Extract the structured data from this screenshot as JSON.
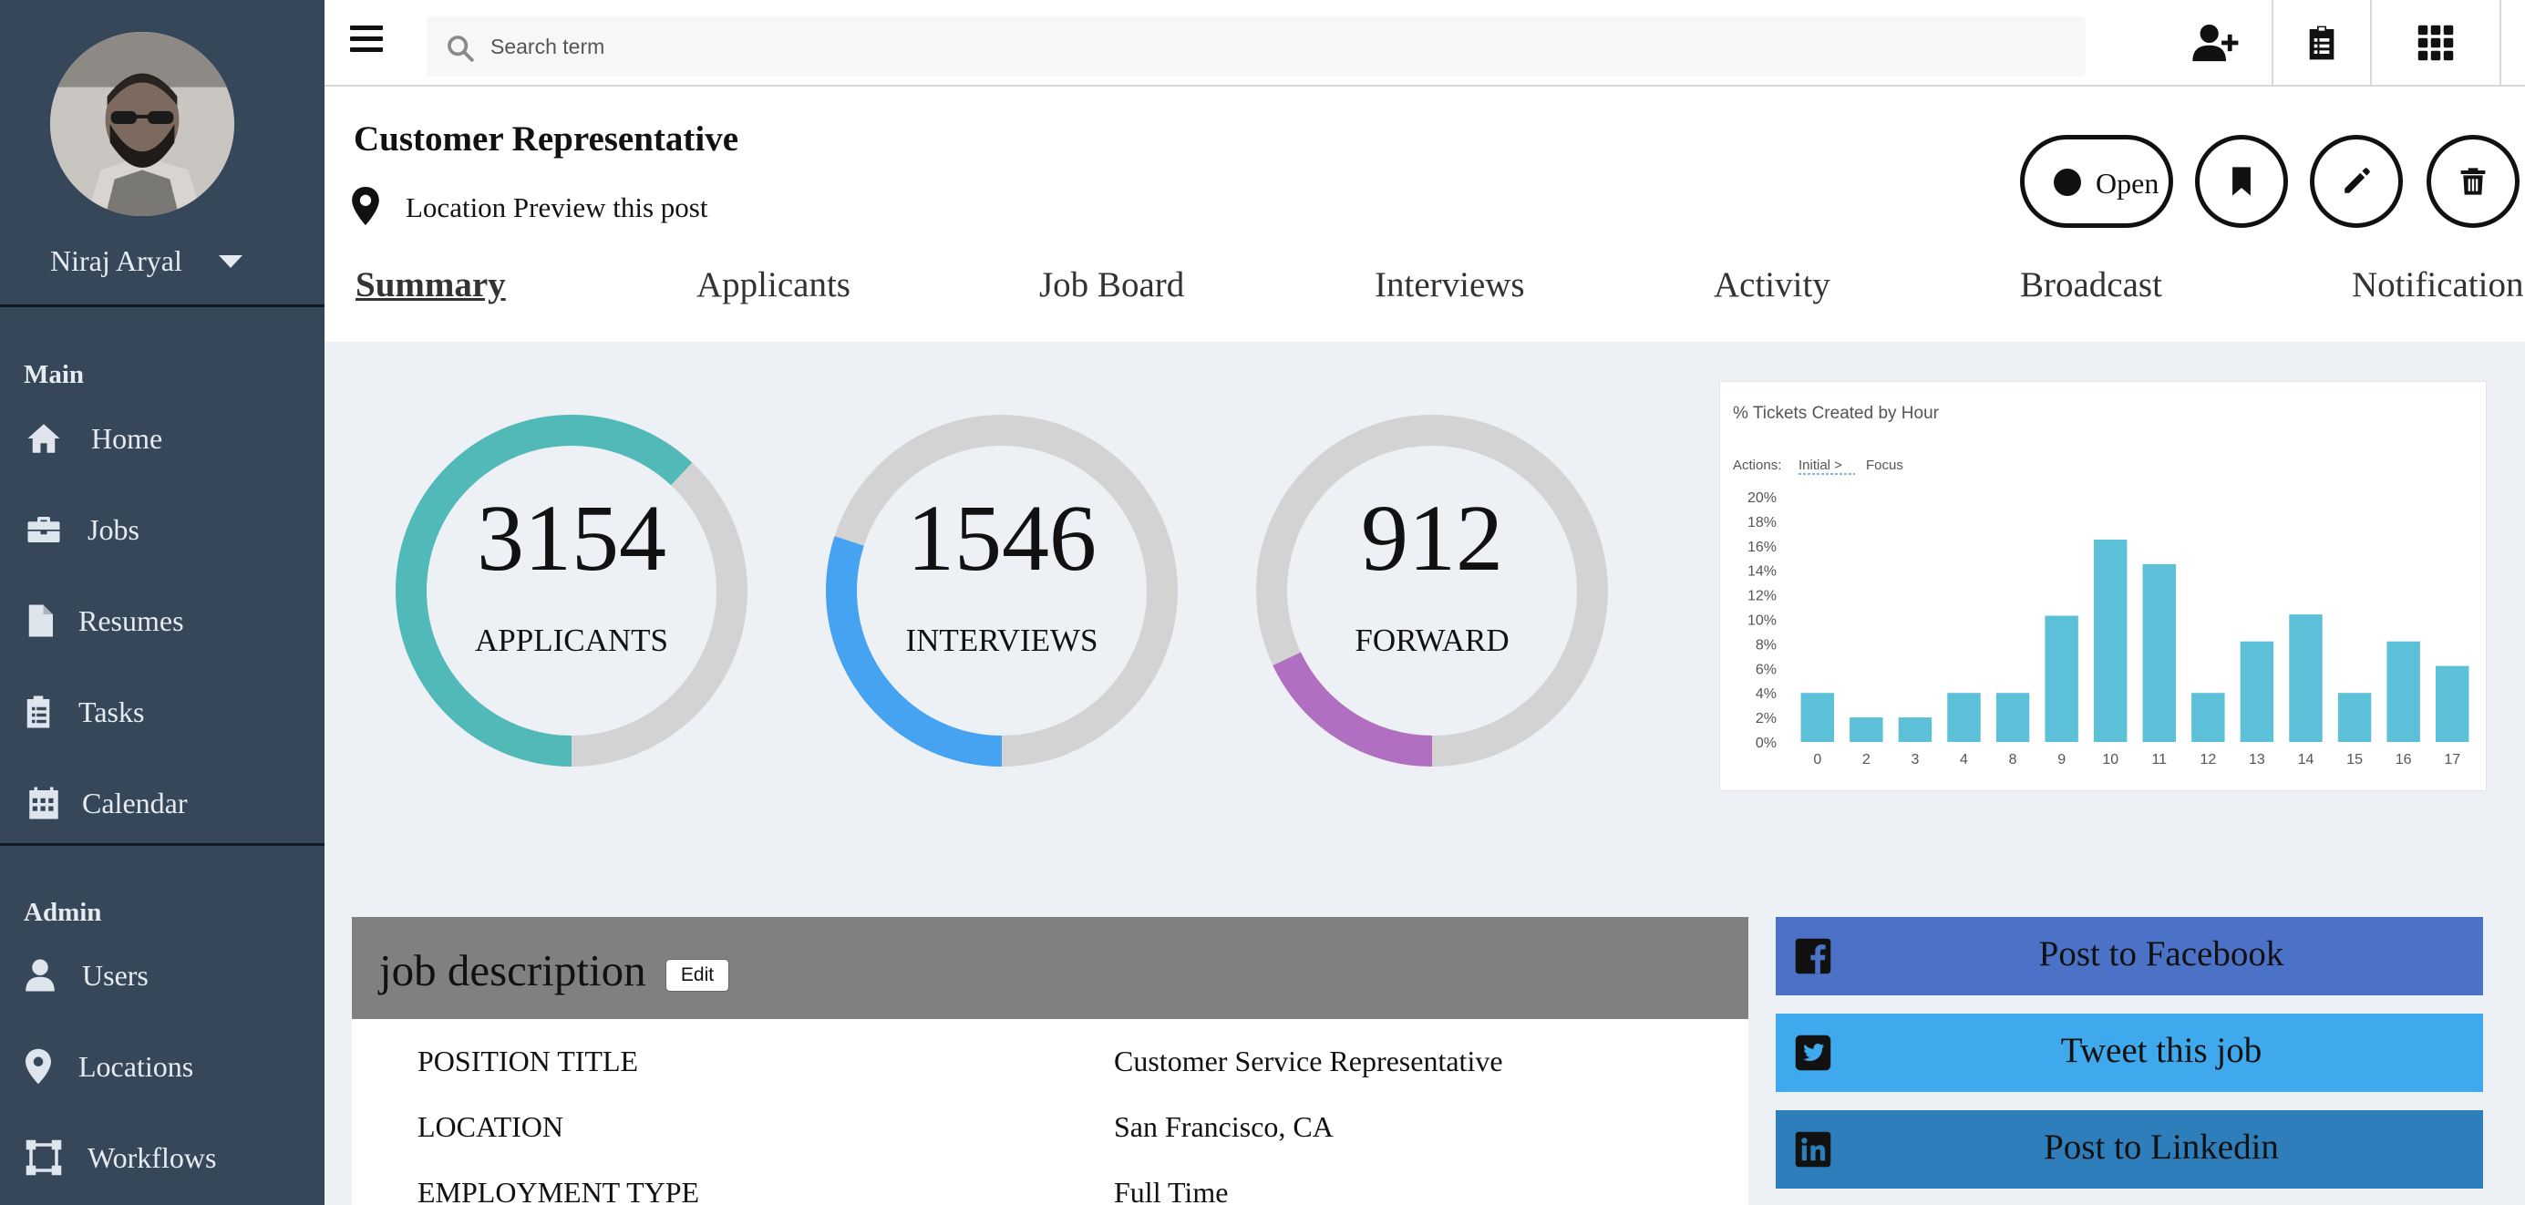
{
  "sidebar": {
    "user_name": "Niraj Aryal",
    "sections": {
      "main": "Main",
      "admin": "Admin"
    },
    "items": [
      {
        "label": "Home",
        "icon": "home-icon"
      },
      {
        "label": "Jobs",
        "icon": "briefcase-icon"
      },
      {
        "label": "Resumes",
        "icon": "file-icon"
      },
      {
        "label": "Tasks",
        "icon": "clipboard-list-icon"
      },
      {
        "label": "Calendar",
        "icon": "calendar-icon"
      },
      {
        "label": "Users",
        "icon": "user-icon"
      },
      {
        "label": "Locations",
        "icon": "map-pin-icon"
      },
      {
        "label": "Workflows",
        "icon": "workflow-icon"
      }
    ]
  },
  "topbar": {
    "search_placeholder": "Search term",
    "icons": [
      "menu-icon",
      "search-icon",
      "add-user-icon",
      "clipboard-icon",
      "apps-grid-icon"
    ]
  },
  "header": {
    "title": "Customer Representative",
    "location_text": "Location Preview this post",
    "open_label": "Open"
  },
  "tabs": [
    "Summary",
    "Applicants",
    "Job Board",
    "Interviews",
    "Activity",
    "Broadcast",
    "Notification"
  ],
  "stats": [
    {
      "value": "3154",
      "label": "APPLICANTS",
      "fraction": 0.62,
      "color": "#52b9b9"
    },
    {
      "value": "1546",
      "label": "INTERVIEWS",
      "fraction": 0.3,
      "color": "#45a3f2"
    },
    {
      "value": "912",
      "label": "FORWARD",
      "fraction": 0.18,
      "color": "#b06fc0"
    }
  ],
  "chart_data": {
    "type": "bar",
    "title": "% Tickets Created by Hour",
    "actions_label": "Actions:",
    "actions": [
      "Initial >",
      "Focus"
    ],
    "categories": [
      "0",
      "2",
      "3",
      "4",
      "8",
      "9",
      "10",
      "11",
      "12",
      "13",
      "14",
      "15",
      "16",
      "17"
    ],
    "values": [
      4,
      2,
      2,
      4,
      4,
      10.3,
      16.5,
      14.5,
      4,
      8.2,
      10.4,
      4,
      8.2,
      6.2
    ],
    "ylim": [
      0,
      20
    ],
    "yticks": [
      "0%",
      "2%",
      "4%",
      "6%",
      "8%",
      "10%",
      "12%",
      "14%",
      "16%",
      "18%",
      "20%"
    ],
    "bar_color": "#5bc0d8",
    "grid": false
  },
  "job_description": {
    "title": "job description",
    "edit_label": "Edit",
    "rows": [
      {
        "key": "POSITION TITLE",
        "value": "Customer Service Representative"
      },
      {
        "key": "LOCATION",
        "value": "San Francisco, CA"
      },
      {
        "key": "EMPLOYMENT TYPE",
        "value": "Full Time"
      }
    ]
  },
  "share": [
    {
      "label": "Post to Facebook",
      "icon": "facebook-icon",
      "color": "#4b72c6"
    },
    {
      "label": "Tweet this job",
      "icon": "twitter-icon",
      "color": "#3ea9ec"
    },
    {
      "label": "Post to Linkedin",
      "icon": "linkedin-icon",
      "color": "#2e7ebc"
    }
  ]
}
